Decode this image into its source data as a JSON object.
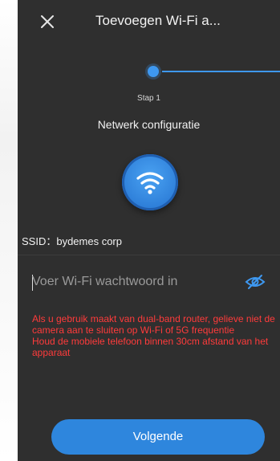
{
  "header": {
    "title": "Toevoegen Wi-Fi a..."
  },
  "stepper": {
    "label": "Stap 1",
    "name": "Netwerk configuratie"
  },
  "ssid": {
    "text": "SSID：bydemes corp"
  },
  "password": {
    "placeholder": "Voer Wi-Fi wachtwoord in",
    "value": ""
  },
  "warnings": [
    "Als u gebruik maakt van dual-band router, gelieve niet de camera aan te sluiten op Wi-Fi of 5G frequentie",
    "Houd de mobiele telefoon binnen 30cm afstand van het apparaat"
  ],
  "footer": {
    "next_label": "Volgende"
  },
  "colors": {
    "accent": "#2e86dd",
    "warning": "#ff3b3b",
    "background": "#2f2f2f"
  },
  "icons": {
    "close": "close-icon",
    "wifi": "wifi-icon",
    "eye": "eye-off-icon"
  }
}
